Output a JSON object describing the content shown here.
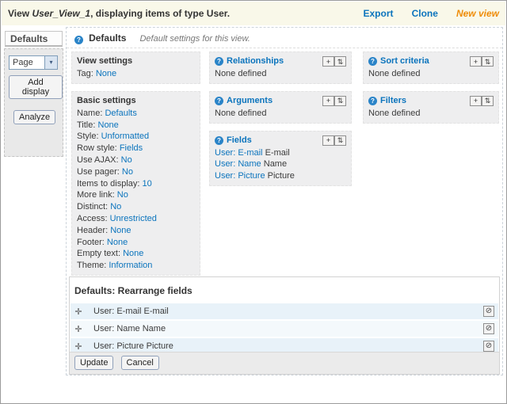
{
  "colors": {
    "link_blue": "#0b74bd",
    "new_view_orange": "#ef8c08",
    "topbar_bg": "#f9f8e9",
    "box_bg": "#eeeeef",
    "row_blue": "#e8f2f9",
    "row_alt": "#f4f9fc"
  },
  "icons": {
    "help": "?",
    "add": "+",
    "rearrange": "⇅",
    "drag": "✛",
    "remove": "⊘",
    "select_arrow": "▾"
  },
  "topbar": {
    "prefix": "View ",
    "view_name": "User_View_1",
    "suffix": ", displaying items of type User.",
    "export": "Export",
    "clone": "Clone",
    "new_view": "New view"
  },
  "sidebar": {
    "tab_label": "Defaults",
    "display_type": "Page",
    "add_display": "Add display",
    "analyze": "Analyze"
  },
  "overview": {
    "title": "Defaults",
    "subtitle": "Default settings for this view."
  },
  "view_settings": {
    "title": "View settings",
    "items": [
      {
        "label": "Tag:",
        "value": "None"
      }
    ]
  },
  "basic_settings": {
    "title": "Basic settings",
    "items": [
      {
        "label": "Name:",
        "value": "Defaults"
      },
      {
        "label": "Title:",
        "value": "None"
      },
      {
        "label": "Style:",
        "value": "Unformatted"
      },
      {
        "label": "Row style:",
        "value": "Fields"
      },
      {
        "label": "Use AJAX:",
        "value": "No"
      },
      {
        "label": "Use pager:",
        "value": "No"
      },
      {
        "label": "Items to display:",
        "value": "10"
      },
      {
        "label": "More link:",
        "value": "No"
      },
      {
        "label": "Distinct:",
        "value": "No"
      },
      {
        "label": "Access:",
        "value": "Unrestricted"
      },
      {
        "label": "Header:",
        "value": "None"
      },
      {
        "label": "Footer:",
        "value": "None"
      },
      {
        "label": "Empty text:",
        "value": "None"
      },
      {
        "label": "Theme:",
        "value": "Information"
      }
    ]
  },
  "relationships": {
    "title": "Relationships",
    "empty": "None defined"
  },
  "arguments": {
    "title": "Arguments",
    "empty": "None defined"
  },
  "fields": {
    "title": "Fields",
    "items": [
      {
        "link": "User: E-mail",
        "text": "E-mail"
      },
      {
        "link": "User: Name",
        "text": "Name"
      },
      {
        "link": "User: Picture",
        "text": "Picture"
      }
    ]
  },
  "sort_criteria": {
    "title": "Sort criteria",
    "empty": "None defined"
  },
  "filters": {
    "title": "Filters",
    "empty": "None defined"
  },
  "rearrange": {
    "title": "Defaults: Rearrange fields",
    "rows": [
      {
        "label": "User: E-mail E-mail"
      },
      {
        "label": "User: Name Name"
      },
      {
        "label": "User: Picture Picture"
      }
    ],
    "update": "Update",
    "cancel": "Cancel"
  }
}
